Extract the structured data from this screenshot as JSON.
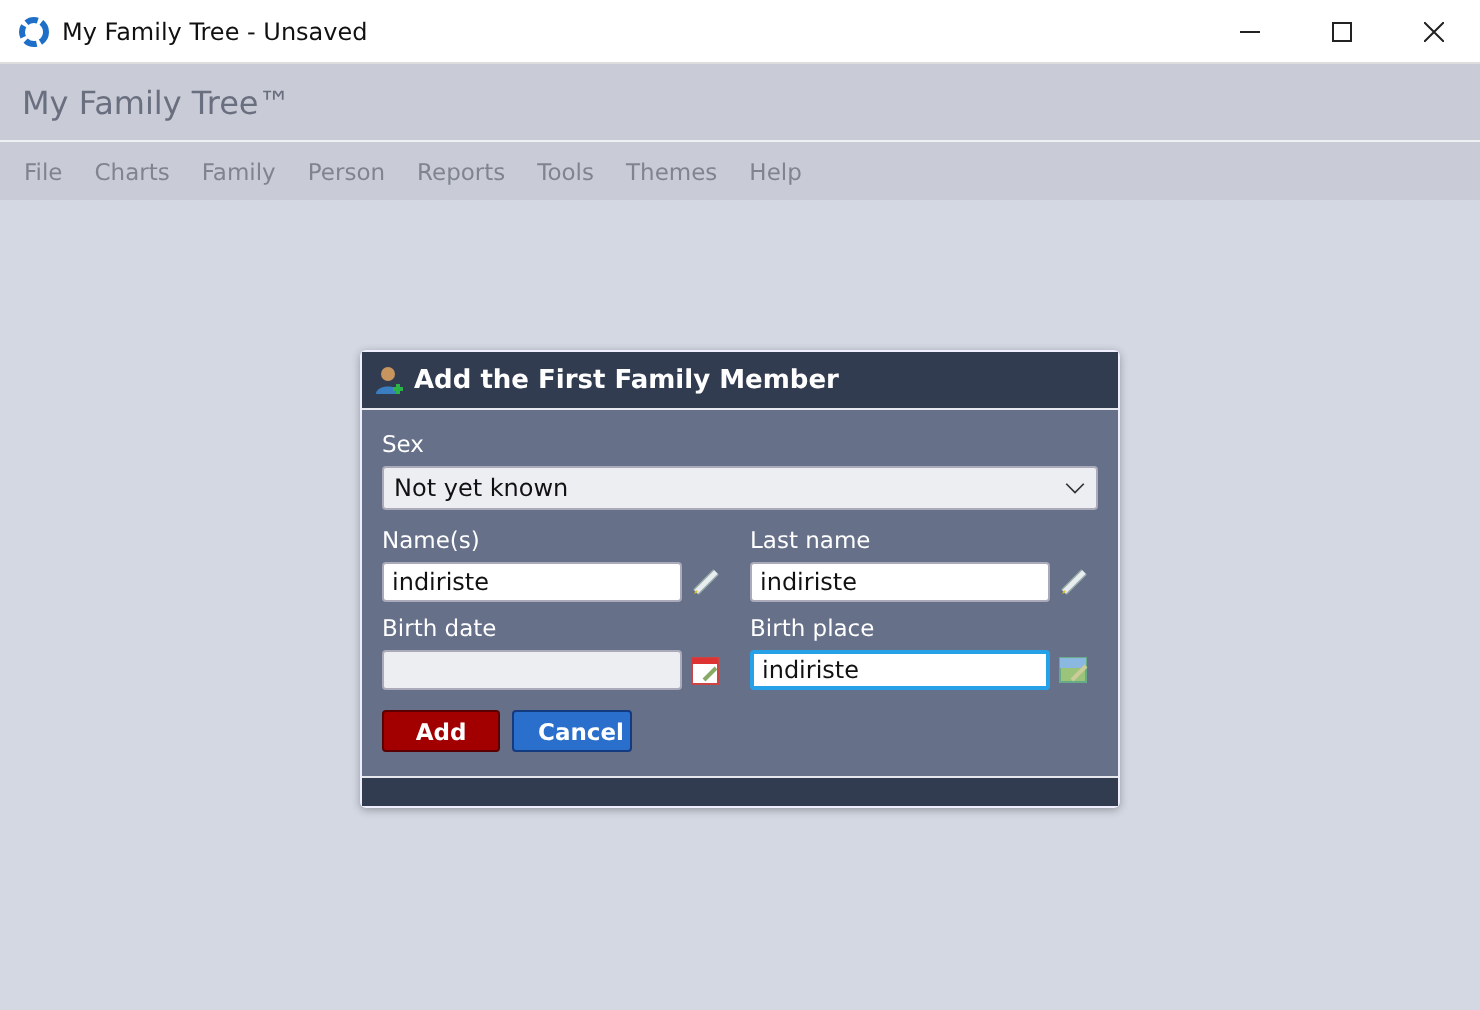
{
  "window": {
    "title": "My Family Tree - Unsaved"
  },
  "app_title": "My Family Tree™",
  "menu": [
    {
      "label": "File",
      "disabled": true
    },
    {
      "label": "Charts",
      "disabled": true
    },
    {
      "label": "Family",
      "disabled": true
    },
    {
      "label": "Person",
      "disabled": true
    },
    {
      "label": "Reports",
      "disabled": true
    },
    {
      "label": "Tools",
      "disabled": true
    },
    {
      "label": "Themes",
      "disabled": true
    },
    {
      "label": "Help",
      "disabled": true
    }
  ],
  "dialog": {
    "title": "Add the First Family Member",
    "sex": {
      "label": "Sex",
      "value": "Not yet known"
    },
    "fields": [
      {
        "label": "Name(s)",
        "value": "indiriste",
        "kind": "name",
        "focused": false
      },
      {
        "label": "Last name",
        "value": "indiriste",
        "kind": "name",
        "focused": false
      },
      {
        "label": "Birth date",
        "kind": "date",
        "focused": false
      },
      {
        "label": "Birth place",
        "value": "indiriste",
        "kind": "place",
        "focused": true
      }
    ],
    "buttons": [
      {
        "label": "Add",
        "kind": "primary"
      },
      {
        "label": "Cancel",
        "kind": "secondary"
      }
    ]
  }
}
